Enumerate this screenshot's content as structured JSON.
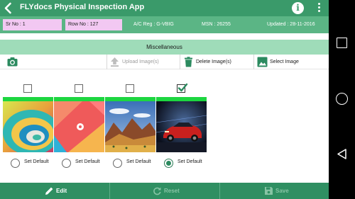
{
  "header": {
    "title": "FLYdocs Physical Inspection App",
    "back_icon": "arrow-left-icon",
    "info_icon": "info-icon",
    "info_glyph": "i",
    "menu_icon": "more-vert-icon"
  },
  "info": {
    "sr_no": "Sr No : 1",
    "row_no": "Row No : 127",
    "ac_reg": "A/C Reg : G-VBIG",
    "msn": "MSN : 26255",
    "updated": "Updated : 28-11-2016"
  },
  "section": {
    "title": "Miscellaneous"
  },
  "toolbar": {
    "camera_icon": "camera-icon",
    "upload_label": "Upload Image(s)",
    "delete_label": "Delete Image(s)",
    "select_label": "Select Image"
  },
  "images": [
    {
      "thumbnail": "abstract-swirl-wallpaper",
      "checked": false,
      "default_label": "Set Default",
      "is_default": false
    },
    {
      "thumbnail": "material-wallpaper",
      "checked": false,
      "default_label": "Set Default",
      "is_default": false
    },
    {
      "thumbnail": "desert-mountains-photo",
      "checked": false,
      "default_label": "Set Default",
      "is_default": false
    },
    {
      "thumbnail": "red-sports-car-photo",
      "checked": true,
      "default_label": "Set Default",
      "is_default": true
    }
  ],
  "bottom": {
    "edit_label": "Edit",
    "reset_label": "Reset",
    "save_label": "Save"
  },
  "colors": {
    "header_bg": "#3a9a6a",
    "info_bg": "#5bb585",
    "pill_bg": "#f2c8f2",
    "section_bg": "#9fdcb9",
    "selection_bar": "#1dd640",
    "bottom_bg": "#2f8f62"
  }
}
